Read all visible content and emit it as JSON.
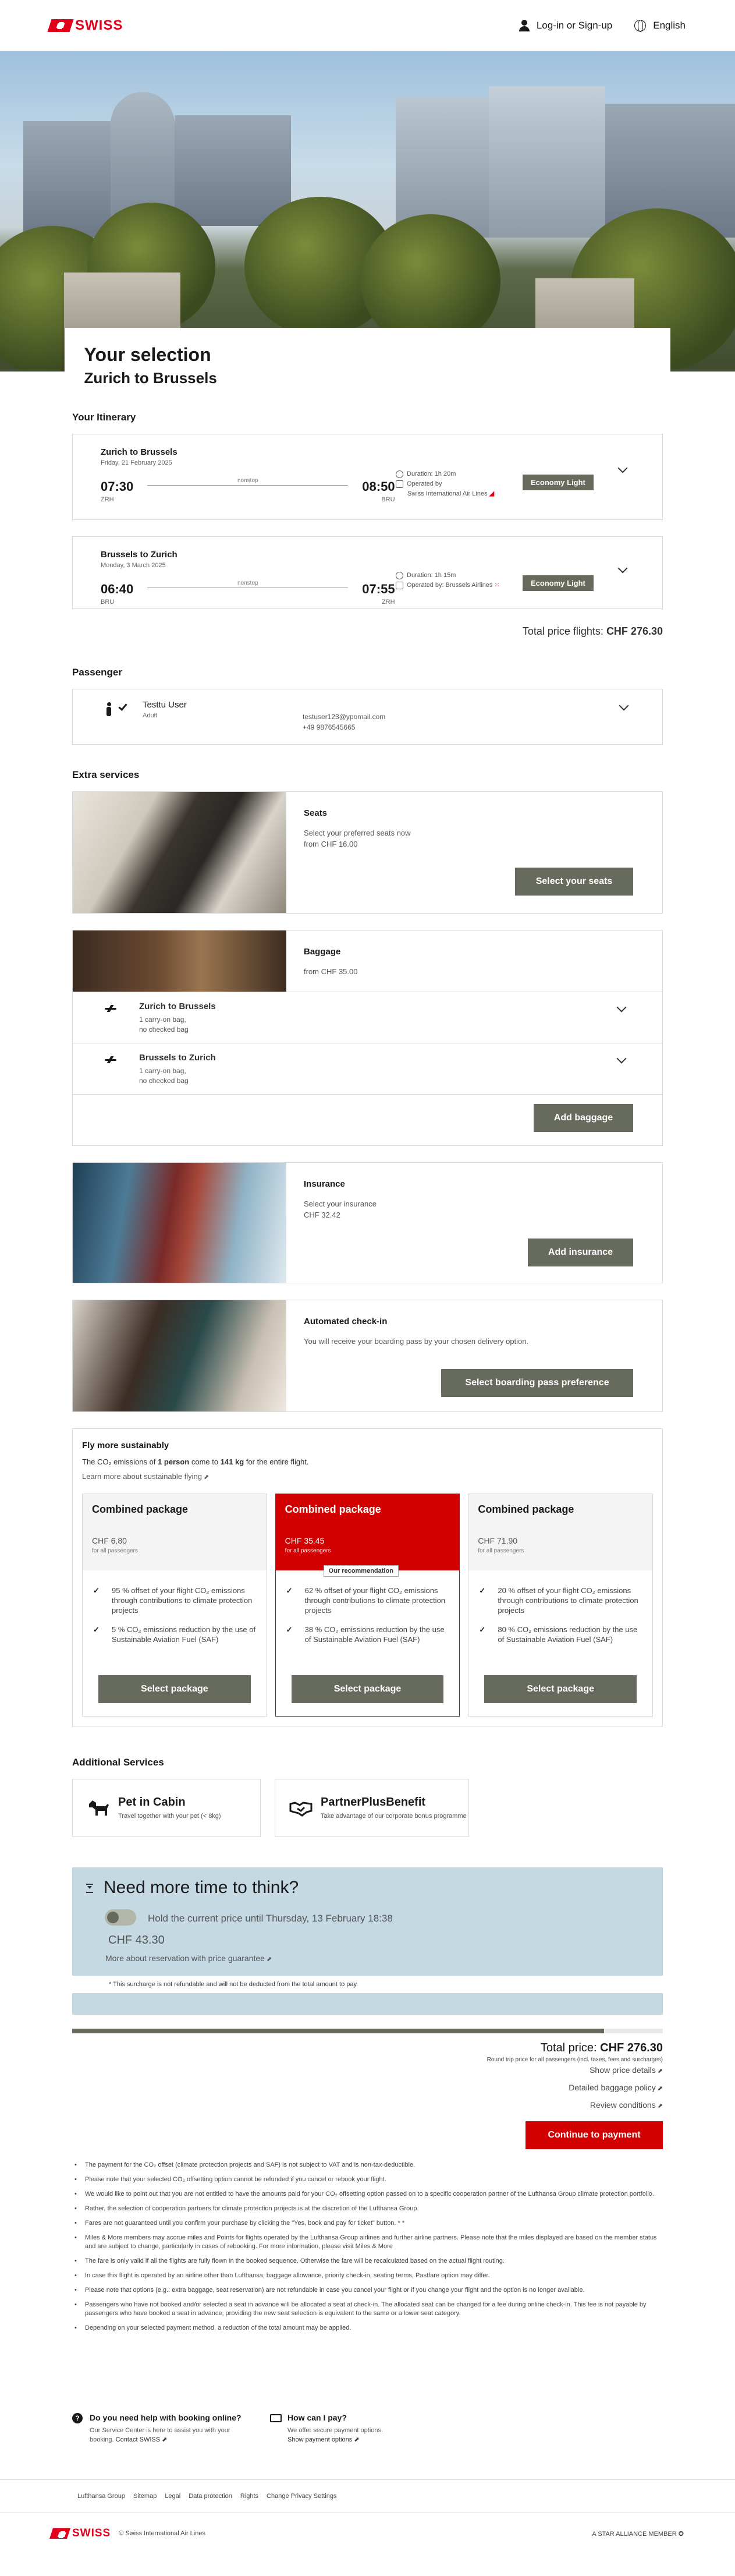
{
  "header": {
    "logo": "SWISS",
    "login_label": "Log-in or Sign-up",
    "language_label": "English"
  },
  "selection": {
    "title": "Your selection",
    "route": "Zurich to Brussels"
  },
  "itinerary": {
    "section_title": "Your Itinerary",
    "flights": [
      {
        "route": "Zurich to Brussels",
        "date": "Friday, 21 February 2025",
        "dep_time": "07:30",
        "dep_code": "ZRH",
        "arr_time": "08:50",
        "arr_code": "BRU",
        "stops": "nonstop",
        "duration": "Duration: 1h 20m",
        "operated": "Operated by",
        "operator": "Swiss International Air Lines",
        "fare": "Economy Light"
      },
      {
        "route": "Brussels to Zurich",
        "date": "Monday, 3 March 2025",
        "dep_time": "06:40",
        "dep_code": "BRU",
        "arr_time": "07:55",
        "arr_code": "ZRH",
        "stops": "nonstop",
        "duration": "Duration: 1h 15m",
        "operated": "Operated by: Brussels Airlines",
        "operator": "",
        "fare": "Economy Light"
      }
    ],
    "total_label": "Total price flights:",
    "total_value": "CHF 276.30"
  },
  "passenger": {
    "section_title": "Passenger",
    "name": "Testtu User",
    "type": "Adult",
    "email": "testuser123@ypomail.com",
    "phone": "+49 9876545665"
  },
  "extras": {
    "section_title": "Extra services",
    "seats": {
      "title": "Seats",
      "desc": "Select your preferred seats now",
      "price": "from CHF 16.00",
      "button": "Select your seats"
    },
    "baggage": {
      "title": "Baggage",
      "price": "from CHF 35.00",
      "rows": [
        {
          "route": "Zurich to Brussels",
          "line1": "1 carry-on bag,",
          "line2": "no checked bag"
        },
        {
          "route": "Brussels to Zurich",
          "line1": "1 carry-on bag,",
          "line2": "no checked bag"
        }
      ],
      "button": "Add baggage"
    },
    "insurance": {
      "title": "Insurance",
      "desc": "Select your insurance",
      "price": "CHF 32.42",
      "button": "Add insurance"
    },
    "checkin": {
      "title": "Automated check-in",
      "desc": "You will receive your boarding pass by your chosen delivery option.",
      "button": "Select boarding pass preference"
    }
  },
  "sustainable": {
    "title": "Fly more sustainably",
    "line1_pre": "The CO₂ emissions of",
    "line1_person": "1 person",
    "line1_mid": "come to",
    "line1_kg": "141 kg",
    "line1_post": "for the entire flight.",
    "learn_more": "Learn more about sustainable flying",
    "packages": [
      {
        "title": "Combined package",
        "price": "CHF 6.80",
        "sub": "for all passengers",
        "items": [
          "95 % offset of your flight CO₂ emissions through contributions to climate protection projects",
          "5 % CO₂ emissions reduction by the use of Sustainable Aviation Fuel (SAF)"
        ],
        "button": "Select package"
      },
      {
        "title": "Combined package",
        "price": "CHF 35.45",
        "sub": "for all passengers",
        "tag": "Our recommendation",
        "items": [
          "62 % offset of your flight CO₂ emissions through contributions to climate protection projects",
          "38 % CO₂ emissions reduction by the use of Sustainable Aviation Fuel (SAF)"
        ],
        "button": "Select package"
      },
      {
        "title": "Combined package",
        "price": "CHF 71.90",
        "sub": "for all passengers",
        "items": [
          "20 % offset of your flight CO₂ emissions through contributions to climate protection projects",
          "80 % CO₂ emissions reduction by the use of Sustainable Aviation Fuel (SAF)"
        ],
        "button": "Select package"
      }
    ]
  },
  "additional": {
    "section_title": "Additional Services",
    "cards": [
      {
        "title": "Pet in Cabin",
        "desc": "Travel together with your pet (< 8kg)"
      },
      {
        "title": "PartnerPlusBenefit",
        "desc": "Take advantage of our corporate bonus programme"
      }
    ]
  },
  "hold": {
    "title": "Need more time to think?",
    "text": "Hold the current price until Thursday, 13 February 18:38",
    "price": "CHF 43.30",
    "more": "More about reservation with price guarantee",
    "note": "* This surcharge is not refundable and will not be deducted from the total amount to pay."
  },
  "summary": {
    "progress": 0.9,
    "total_label": "Total price:",
    "total_value": "CHF 276.30",
    "round_note": "Round trip price for all passengers (incl. taxes, fees and surcharges)",
    "show_details": "Show price details",
    "baggage_policy": "Detailed baggage policy",
    "review_conditions": "Review conditions",
    "continue": "Continue to payment"
  },
  "notes": [
    "The payment for the CO₂ offset (climate protection projects and SAF) is not subject to VAT and is non-tax-deductible.",
    "Please note that your selected CO₂ offsetting option cannot be refunded if you cancel or rebook your flight.",
    "We would like to point out that you are not entitled to have the amounts paid for your CO₂ offsetting option passed on to a specific cooperation partner of the Lufthansa Group climate protection portfolio.",
    "Rather, the selection of cooperation partners for climate protection projects is at the discretion of the Lufthansa Group.",
    "Fares are not guaranteed until you confirm your purchase by clicking the \"Yes, book and pay for ticket\" button. * *",
    "Miles & More members may accrue miles and Points for flights operated by the Lufthansa Group airlines and further airline partners. Please note that the miles displayed are based on the member status and are subject to change, particularly in cases of rebooking. For more information, please visit Miles & More",
    "The fare is only valid if all the flights are fully flown in the booked sequence. Otherwise the fare will be recalculated based on the actual flight routing.",
    "In case this flight is operated by an airline other than Lufthansa, baggage allowance, priority check-in, seating terms, Pastfare option may differ.",
    "Please note that options (e.g.: extra baggage, seat reservation) are not refundable in case you cancel your flight or if you change your flight and the option is no longer available.",
    "Passengers who have not booked and/or selected a seat in advance will be allocated a seat at check-in. The allocated seat can be changed for a fee during online check-in. This fee is not payable by passengers who have booked a seat in advance, providing the new seat selection is equivalent to the same or a lower seat category.",
    "Depending on your selected payment method, a reduction of the total amount may be applied."
  ],
  "help": [
    {
      "title": "Do you need help with booking online?",
      "desc": "Our Service Center is here to assist you with your booking.",
      "link": "Contact SWISS"
    },
    {
      "title": "How can I pay?",
      "desc": "We offer secure payment options.",
      "link": "Show payment options"
    }
  ],
  "footer": {
    "links": [
      "Lufthansa Group",
      "Sitemap",
      "Legal",
      "Data protection",
      "Rights",
      "Change Privacy Settings"
    ],
    "copyright": "© Swiss International Air Lines",
    "alliance": "A STAR ALLIANCE MEMBER"
  },
  "colors": {
    "brand_red": "#e2001a",
    "button_grey": "#676b5d",
    "hold_bg": "#c5d9e3"
  }
}
